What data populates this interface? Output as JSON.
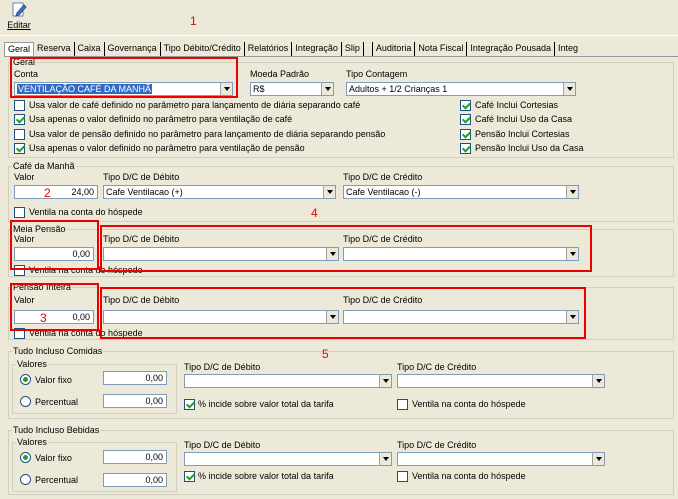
{
  "toolbar": {
    "edit_label": "Editar"
  },
  "tabs": [
    {
      "label": "Geral"
    },
    {
      "label": "Reserva"
    },
    {
      "label": "Caixa"
    },
    {
      "label": "Governança"
    },
    {
      "label": "Tipo Débito/Crédito"
    },
    {
      "label": "Relatórios"
    },
    {
      "label": "Integração"
    },
    {
      "label": "Slip"
    },
    {
      "label": "Auditoria"
    },
    {
      "label": "Nota Fiscal"
    },
    {
      "label": "Integração Pousada"
    },
    {
      "label": "Integ"
    }
  ],
  "geral": {
    "legend": "Geral",
    "conta_label": "Conta",
    "conta_value": "VENTILAÇÃO CAFÉ DA MANHÃ",
    "moeda_label": "Moeda Padrão",
    "moeda_value": "R$",
    "contagem_label": "Tipo Contagem",
    "contagem_value": "Adultos + 1/2 Crianças 1",
    "options_left": [
      {
        "label": "Usa valor de café definido no parâmetro para lançamento de diária separando café",
        "checked": false
      },
      {
        "label": "Usa apenas o valor definido no parâmetro para ventilação de café",
        "checked": true
      },
      {
        "label": "Usa valor de pensão definido no parâmetro para lançamento de diária separando pensão",
        "checked": false
      },
      {
        "label": "Usa apenas o valor definido no parâmetro para ventilação de pensão",
        "checked": true
      }
    ],
    "options_right": [
      {
        "label": "Café Inclui Cortesias",
        "checked": true
      },
      {
        "label": "Café Inclui Uso da Casa",
        "checked": true
      },
      {
        "label": "Pensão Inclui Cortesias",
        "checked": true
      },
      {
        "label": "Pensão Inclui Uso da Casa",
        "checked": true
      }
    ]
  },
  "cafe": {
    "legend": "Café da Manhã",
    "valor_label": "Valor",
    "valor": "24,00",
    "debito_label": "Tipo D/C de Débito",
    "debito_value": "Cafe Ventilacao (+)",
    "credito_label": "Tipo D/C de Crédito",
    "credito_value": "Cafe Ventilacao (-)",
    "ventila_label": "Ventila na conta do hóspede"
  },
  "meia": {
    "legend": "Meia Pensão",
    "valor_label": "Valor",
    "valor": "0,00",
    "debito_label": "Tipo D/C de Débito",
    "credito_label": "Tipo D/C de Crédito",
    "ventila_label": "Ventila na conta do hóspede"
  },
  "inteira": {
    "legend": "Pensão Inteira",
    "valor_label": "Valor",
    "valor": "0,00",
    "debito_label": "Tipo D/C de Débito",
    "credito_label": "Tipo D/C de Crédito",
    "ventila_label": "Ventila na conta do hóspede"
  },
  "comidas": {
    "legend": "Tudo Incluso Comidas",
    "valores_legend": "Valores",
    "fixo_label": "Valor fixo",
    "fixo_value": "0,00",
    "percentual_label": "Percentual",
    "percentual_value": "0,00",
    "debito_label": "Tipo D/C de Débito",
    "credito_label": "Tipo D/C de Crédito",
    "incide_label": "% incide sobre valor total da tarifa",
    "ventila_label": "Ventila na conta do hóspede"
  },
  "bebidas": {
    "legend": "Tudo Incluso Bebidas",
    "valores_legend": "Valores",
    "fixo_label": "Valor fixo",
    "fixo_value": "0,00",
    "percentual_label": "Percentual",
    "percentual_value": "0,00",
    "debito_label": "Tipo D/C de Débito",
    "credito_label": "Tipo D/C de Crédito",
    "incide_label": "% incide sobre valor total da tarifa",
    "ventila_label": "Ventila na conta do hóspede"
  },
  "annotations": {
    "n1": "1",
    "n2": "2",
    "n3": "3",
    "n4": "4",
    "n5": "5"
  }
}
